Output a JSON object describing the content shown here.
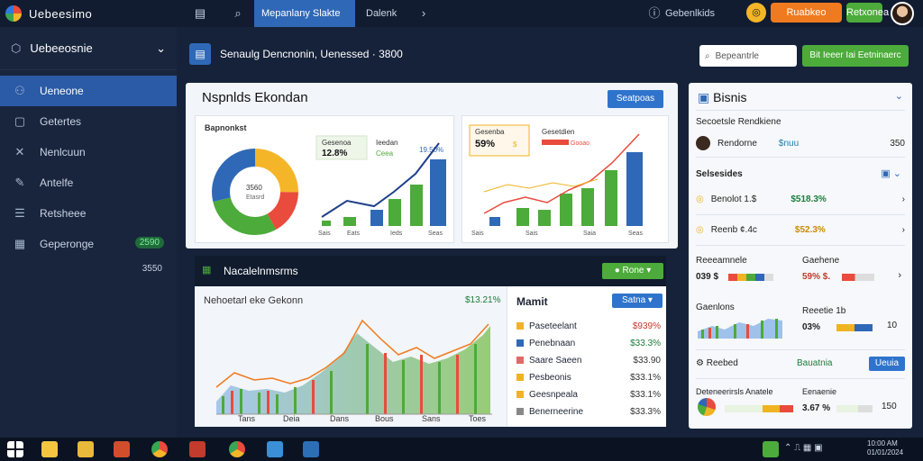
{
  "app": {
    "title": "Uebeesimo"
  },
  "topbar": {
    "tabs": [
      "Mepanlany Slakte",
      "Dalenk"
    ],
    "status": "Gebenlkids",
    "btn_orange1": "Ruabkeo",
    "btn_green": "Retxonea",
    "orange_badge_icon": "coin-icon"
  },
  "sidebar": {
    "header": "Uebeeosnie",
    "items": [
      {
        "label": "Ueneone",
        "icon": "person-icon"
      },
      {
        "label": "Getertes",
        "icon": "square-icon"
      },
      {
        "label": "Nenlcuun",
        "icon": "tools-icon"
      },
      {
        "label": "Antelfe",
        "icon": "pen-icon"
      },
      {
        "label": "Retsheee",
        "icon": "list-icon"
      },
      {
        "label": "Geperonge",
        "icon": "grid-icon",
        "badge": "2590"
      }
    ],
    "sub_value": "3550"
  },
  "main": {
    "header": "Senaulg Dencnonin, Uenessed  ·  3800",
    "search_placeholder": "Bepeantrle",
    "top_button": "Bit Ieeer Iai Eetninaerc"
  },
  "card1": {
    "title": "Nspnlds Ekondan",
    "button": "Seatpoas",
    "pie_label": "Bapnonkst",
    "pie_center": "3560\nEtasrd",
    "kpi1": {
      "title": "Gesenoa",
      "value": "12.8%"
    },
    "kpi2": {
      "title": "Ieedan",
      "value": "Ceea"
    },
    "kpi2_pct": "19.50%",
    "kpi3": {
      "title": "Gesenba",
      "value": "59%"
    },
    "kpi4": {
      "title": "Gesetdien",
      "value": "Gooao"
    },
    "x1": [
      "Sais",
      "Eats",
      "Ieds",
      "Seas"
    ],
    "x2": [
      "Sais",
      "Sais",
      "Saia",
      "Seas"
    ]
  },
  "card2": {
    "bar_title": "Nacalelnmsrms",
    "bar_button": "Rone",
    "chart_title": "Nehoetarl eke Gekonn",
    "chart_value": "$13.21%",
    "x": [
      "Tans",
      "Deia",
      "Dans",
      "Bous",
      "Sans",
      "Toes"
    ]
  },
  "legend": {
    "title": "Mamit",
    "button": "Satna",
    "rows": [
      {
        "label": "Paseteelant",
        "value": "$939%",
        "color": "#f0b323"
      },
      {
        "label": "Penebnaan",
        "value": "$33.3%",
        "color": "#2f68b7"
      },
      {
        "label": "Saare Saeen",
        "value": "$33.90",
        "color": "#e06a66"
      },
      {
        "label": "Pesbeonis",
        "value": "$33.1%",
        "color": "#f0b323"
      },
      {
        "label": "Geesnpeala",
        "value": "$33.1%",
        "color": "#f0b323"
      },
      {
        "label": "Benerneerine",
        "value": "$33.3%",
        "color": "#888888"
      }
    ]
  },
  "right": {
    "title": "Bisnis",
    "sect1": "Secoetsle Rendkiene",
    "person1": "Rendorne",
    "person1_tag": "$nuu",
    "person1_val": "350",
    "sect2": "Selsesides",
    "row1": {
      "label": "Benolot 1.$",
      "value": "$518.3%"
    },
    "row2": {
      "label": "Reenb ¢.4c",
      "value": "$52.3%"
    },
    "sect3_left": "Reeeamnele",
    "sect3_right": "Gaehene",
    "row3_left": "039 $",
    "row3_right": "59% $.",
    "sect4_left": "Gaenlons",
    "sect4_right": "Reeetie 1b",
    "row4_right": "03%",
    "row4_val": "10",
    "sect5": "Reebed",
    "sect5_btn": "Bauatnia",
    "sect5_btn2": "Ueuia",
    "sect6_left": "Deteneerirsls Anatele",
    "sect6_right": "Eenaenie",
    "row6_right": "3.67 %",
    "row6_val": "150"
  },
  "colors": {
    "accent": "#2f68b7",
    "green": "#4cab3a",
    "orange": "#f07a1f",
    "red": "#e94b3c"
  }
}
